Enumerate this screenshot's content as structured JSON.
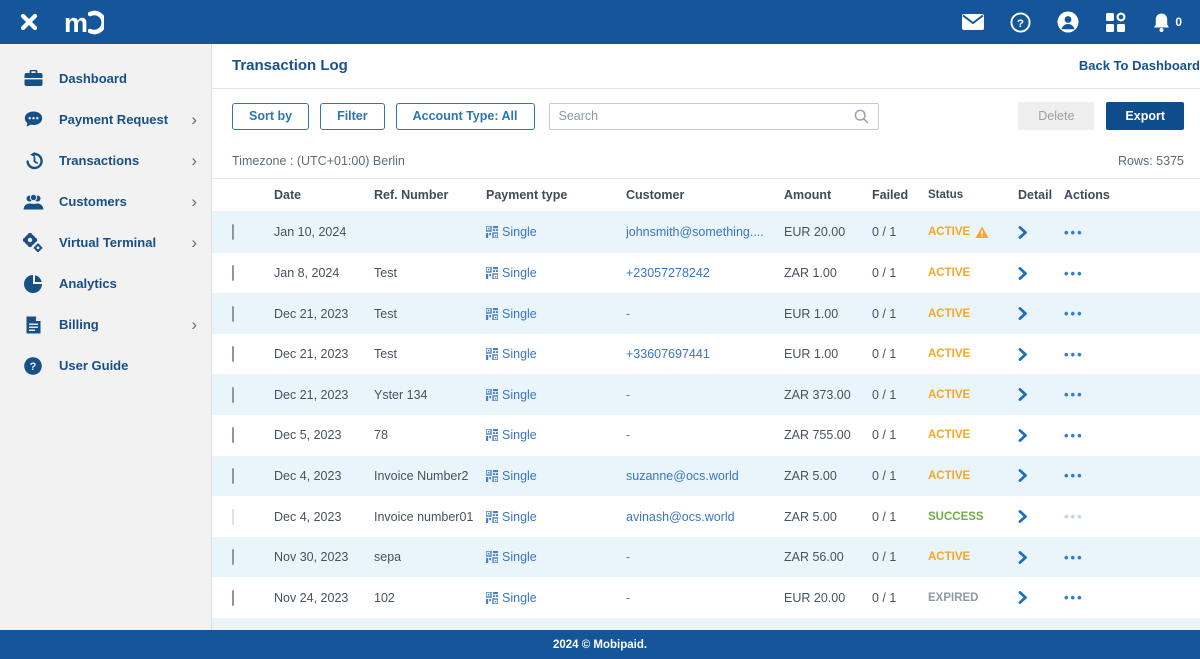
{
  "topbar": {
    "notification_count": "0"
  },
  "sidebar": {
    "items": [
      {
        "label": "Dashboard",
        "icon": "briefcase-icon",
        "chevron": false
      },
      {
        "label": "Payment Request",
        "icon": "chat-bubble-icon",
        "chevron": true
      },
      {
        "label": "Transactions",
        "icon": "history-icon",
        "chevron": true
      },
      {
        "label": "Customers",
        "icon": "users-icon",
        "chevron": true
      },
      {
        "label": "Virtual Terminal",
        "icon": "gears-icon",
        "chevron": true
      },
      {
        "label": "Analytics",
        "icon": "pie-chart-icon",
        "chevron": false
      },
      {
        "label": "Billing",
        "icon": "document-icon",
        "chevron": true
      },
      {
        "label": "User Guide",
        "icon": "question-circle-icon",
        "chevron": false
      }
    ],
    "chevron_glyph": "›"
  },
  "page": {
    "title": "Transaction Log",
    "back_link": "Back To Dashboard"
  },
  "toolbar": {
    "sort_by": "Sort by",
    "filter": "Filter",
    "account_type": "Account Type: All",
    "search_placeholder": "Search",
    "delete_label": "Delete",
    "export_label": "Export"
  },
  "meta": {
    "timezone": "Timezone : (UTC+01:00) Berlin",
    "rows_count": "Rows: 5375"
  },
  "table": {
    "columns": [
      "Date",
      "Ref. Number",
      "Payment type",
      "Customer",
      "Amount",
      "Failed",
      "Status",
      "Detail",
      "Actions"
    ],
    "rows": [
      {
        "date": "Jan 10, 2024",
        "ref": "",
        "payment_type": "Single",
        "customer": "johnsmith@something....",
        "customer_link": true,
        "amount": "EUR 20.00",
        "failed": "0 / 1",
        "status": "ACTIVE",
        "status_color": "#f7a723",
        "warning": true,
        "muted": false
      },
      {
        "date": "Jan 8, 2024",
        "ref": "Test",
        "payment_type": "Single",
        "customer": "+23057278242",
        "customer_link": true,
        "amount": "ZAR 1.00",
        "failed": "0 / 1",
        "status": "ACTIVE",
        "status_color": "#f7a723",
        "warning": false,
        "muted": false
      },
      {
        "date": "Dec 21, 2023",
        "ref": "Test",
        "payment_type": "Single",
        "customer": "-",
        "customer_link": false,
        "amount": "EUR 1.00",
        "failed": "0 / 1",
        "status": "ACTIVE",
        "status_color": "#f7a723",
        "warning": false,
        "muted": false
      },
      {
        "date": "Dec 21, 2023",
        "ref": "Test",
        "payment_type": "Single",
        "customer": "+33607697441",
        "customer_link": true,
        "amount": "EUR 1.00",
        "failed": "0 / 1",
        "status": "ACTIVE",
        "status_color": "#f7a723",
        "warning": false,
        "muted": false
      },
      {
        "date": "Dec 21, 2023",
        "ref": "Yster 134",
        "payment_type": "Single",
        "customer": "-",
        "customer_link": false,
        "amount": "ZAR 373.00",
        "failed": "0 / 1",
        "status": "ACTIVE",
        "status_color": "#f7a723",
        "warning": false,
        "muted": false
      },
      {
        "date": "Dec 5, 2023",
        "ref": "78",
        "payment_type": "Single",
        "customer": "-",
        "customer_link": false,
        "amount": "ZAR 755.00",
        "failed": "0 / 1",
        "status": "ACTIVE",
        "status_color": "#f7a723",
        "warning": false,
        "muted": false
      },
      {
        "date": "Dec 4, 2023",
        "ref": "Invoice Number2",
        "payment_type": "Single",
        "customer": "suzanne@ocs.world",
        "customer_link": true,
        "amount": "ZAR 5.00",
        "failed": "0 / 1",
        "status": "ACTIVE",
        "status_color": "#f7a723",
        "warning": false,
        "muted": false
      },
      {
        "date": "Dec 4, 2023",
        "ref": "Invoice number01",
        "payment_type": "Single",
        "customer": "avinash@ocs.world",
        "customer_link": true,
        "amount": "ZAR 5.00",
        "failed": "0 / 1",
        "status": "SUCCESS",
        "status_color": "#71ad47",
        "warning": false,
        "muted": true
      },
      {
        "date": "Nov 30, 2023",
        "ref": "sepa",
        "payment_type": "Single",
        "customer": "-",
        "customer_link": false,
        "amount": "ZAR 56.00",
        "failed": "0 / 1",
        "status": "ACTIVE",
        "status_color": "#f7a723",
        "warning": false,
        "muted": false
      },
      {
        "date": "Nov 24, 2023",
        "ref": "102",
        "payment_type": "Single",
        "customer": "-",
        "customer_link": false,
        "amount": "EUR 20.00",
        "failed": "0 / 1",
        "status": "EXPIRED",
        "status_color": "#8f9aa3",
        "warning": false,
        "muted": false
      }
    ]
  },
  "footer": {
    "copyright": "2024 © Mobipaid."
  },
  "colors": {
    "topbar": "#15569b",
    "accent": "#2e75b6",
    "export_button": "#0f4c8c",
    "row_alt": "#e9f5fb",
    "status_active": "#f7a723",
    "status_success": "#71ad47",
    "status_expired": "#8f9aa3",
    "link_blue": "#3a76c4",
    "sidebar_text": "#174f87"
  }
}
